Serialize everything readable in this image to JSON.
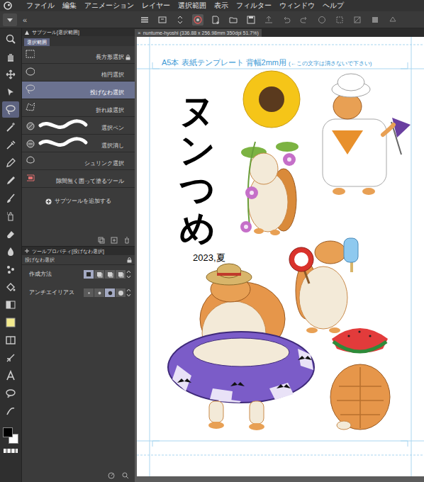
{
  "menu": [
    {
      "label": "ファイル"
    },
    {
      "label": "編集"
    },
    {
      "label": "アニメーション"
    },
    {
      "label": "レイヤー"
    },
    {
      "label": "選択範囲"
    },
    {
      "label": "表示"
    },
    {
      "label": "フィルター"
    },
    {
      "label": "ウィンドウ"
    },
    {
      "label": "ヘルプ"
    }
  ],
  "panel_collapse": "«",
  "tools": [
    {
      "selected": false
    },
    {
      "selected": false
    },
    {
      "selected": false
    },
    {
      "selected": false
    },
    {
      "selected": true
    },
    {
      "selected": false
    },
    {
      "selected": false
    },
    {
      "selected": false
    },
    {
      "selected": false
    },
    {
      "selected": false
    },
    {
      "selected": false
    },
    {
      "selected": false
    },
    {
      "selected": false
    },
    {
      "selected": false
    },
    {
      "selected": false
    },
    {
      "selected": false
    },
    {
      "selected": false
    },
    {
      "selected": false
    },
    {
      "selected": false
    },
    {
      "selected": false
    },
    {
      "selected": false
    },
    {
      "selected": false
    }
  ],
  "colors": {
    "main": "#000000",
    "sub": "#ffffff"
  },
  "subtool": {
    "title": "サブツール[選択範囲]",
    "group": "選択範囲",
    "items": [
      {
        "label": "長方形選択",
        "selected": false,
        "locked": true,
        "kind": "plain"
      },
      {
        "label": "楕円選択",
        "selected": false,
        "locked": false,
        "kind": "plain"
      },
      {
        "label": "投げなわ選択",
        "selected": true,
        "locked": false,
        "kind": "plain"
      },
      {
        "label": "折れ線選択",
        "selected": false,
        "locked": false,
        "kind": "plain"
      },
      {
        "label": "選択ペン",
        "selected": false,
        "locked": false,
        "kind": "stroke"
      },
      {
        "label": "選択消し",
        "selected": false,
        "locked": false,
        "kind": "stroke"
      },
      {
        "label": "シュリンク選択",
        "selected": false,
        "locked": false,
        "kind": "plain"
      },
      {
        "label": "隙間無く囲って塗るツール",
        "selected": false,
        "locked": false,
        "kind": "plain"
      }
    ],
    "add_label": "サブツールを追加する"
  },
  "tool_property": {
    "title": "ツールプロパティ[投げなわ選択]",
    "tool_name": "投げなわ選択",
    "rows": [
      {
        "label": "作成方法",
        "options": [
          {
            "selected": true
          },
          {
            "selected": false
          },
          {
            "selected": false
          },
          {
            "selected": false
          }
        ]
      },
      {
        "label": "アンチエイリアス",
        "options": [
          {
            "selected": false
          },
          {
            "selected": false
          },
          {
            "selected": true
          },
          {
            "selected": false
          }
        ]
      }
    ]
  },
  "document": {
    "tab": "nuntume-hyoshi (336.88 x 256.98mm 350dpi 51.7%)",
    "close": "×",
    "note": "A5本 表紙テンプレート 背幅2mm用",
    "hint": "(←この文字は消さないで下さい)",
    "title": "ヌンつめ",
    "subtitle": "2023,夏"
  }
}
